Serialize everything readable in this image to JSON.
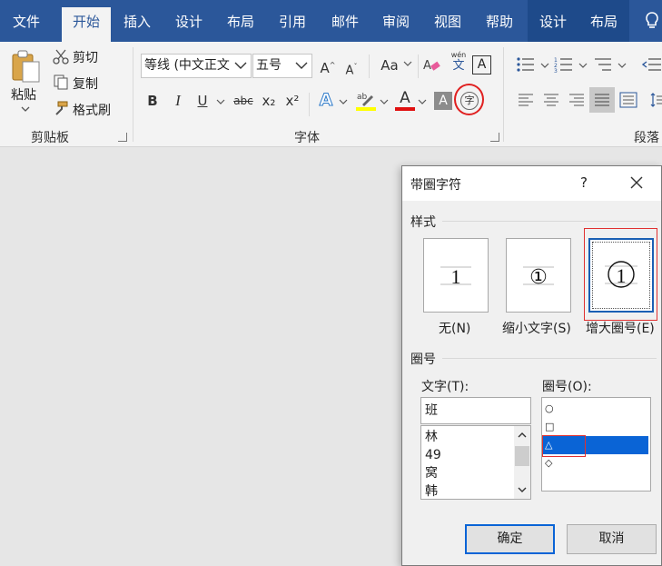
{
  "ribbon_tabs": {
    "file": "文件",
    "home": "开始",
    "insert": "插入",
    "design": "设计",
    "layout": "布局",
    "references": "引用",
    "mailings": "邮件",
    "review": "审阅",
    "view": "视图",
    "help": "帮助",
    "ctx_design": "设计",
    "ctx_layout": "布局"
  },
  "clipboard": {
    "paste": "粘贴",
    "cut": "剪切",
    "copy": "复制",
    "format_painter": "格式刷",
    "group_label": "剪贴板"
  },
  "font": {
    "font_name": "等线 (中文正文",
    "font_size": "五号",
    "group_label": "字体",
    "bold": "B",
    "italic": "I",
    "underline": "U",
    "strike": "abc",
    "subscript": "x₂",
    "superscript": "x²",
    "grow": "A",
    "shrink": "A",
    "case": "Aa",
    "phonetic_top": "wén",
    "phonetic_bottom": "文",
    "border_char": "A",
    "font_color": "A",
    "shade_char": "A",
    "enclose_char": "字"
  },
  "paragraph": {
    "group_label": "段落"
  },
  "dialog": {
    "title": "带圈字符",
    "help": "?",
    "style_label": "样式",
    "style_options": [
      {
        "label": "无(N)",
        "sample": "1"
      },
      {
        "label": "缩小文字(S)",
        "sample": "①"
      },
      {
        "label": "增大圈号(E)",
        "sample": "1"
      }
    ],
    "selected_style": 2,
    "enclosure_label": "圈号",
    "text_label": "文字(T):",
    "text_value": "班",
    "text_list": [
      "林",
      "49",
      "窝",
      "韩"
    ],
    "enclosure_field_label": "圈号(O):",
    "enclosure_options": [
      "○",
      "□",
      "△",
      "◇"
    ],
    "selected_enclosure": 2,
    "ok": "确定",
    "cancel": "取消"
  }
}
